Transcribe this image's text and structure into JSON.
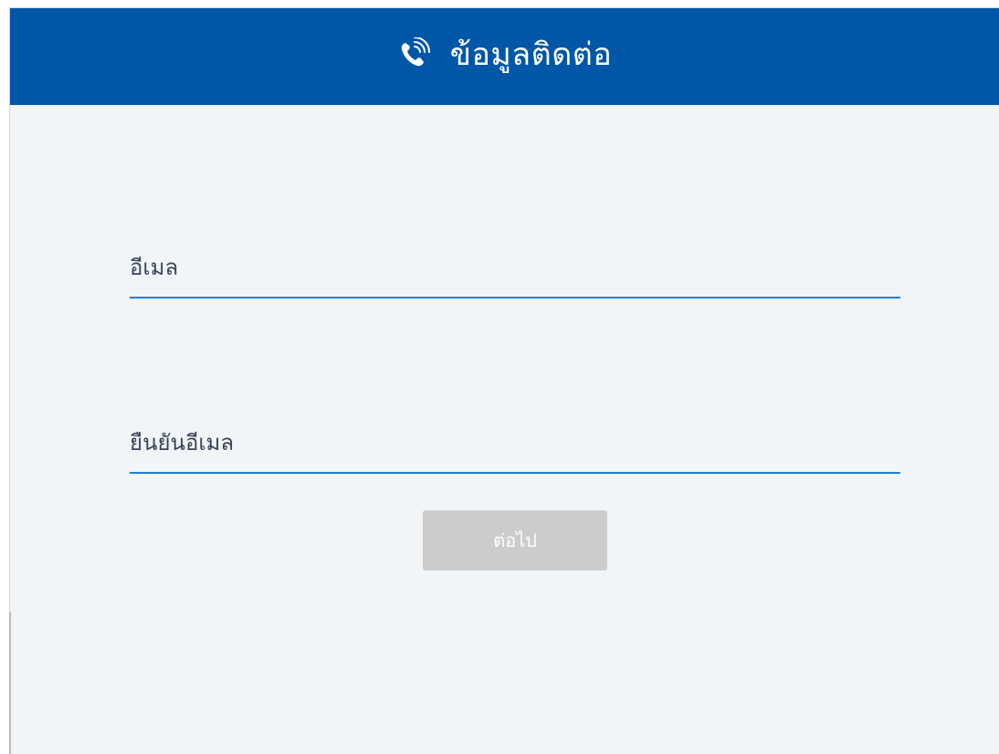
{
  "header": {
    "title": "ข้อมูลติดต่อ",
    "icon": "phone-ringing-icon",
    "background_color": "#0057a8"
  },
  "form": {
    "email": {
      "label": "อีเมล",
      "value": ""
    },
    "confirm_email": {
      "label": "ยืนยันอีเมล",
      "value": ""
    },
    "next_button_label": "ต่อไป",
    "next_button_state": "disabled",
    "accent_color": "#1e7fd6"
  }
}
